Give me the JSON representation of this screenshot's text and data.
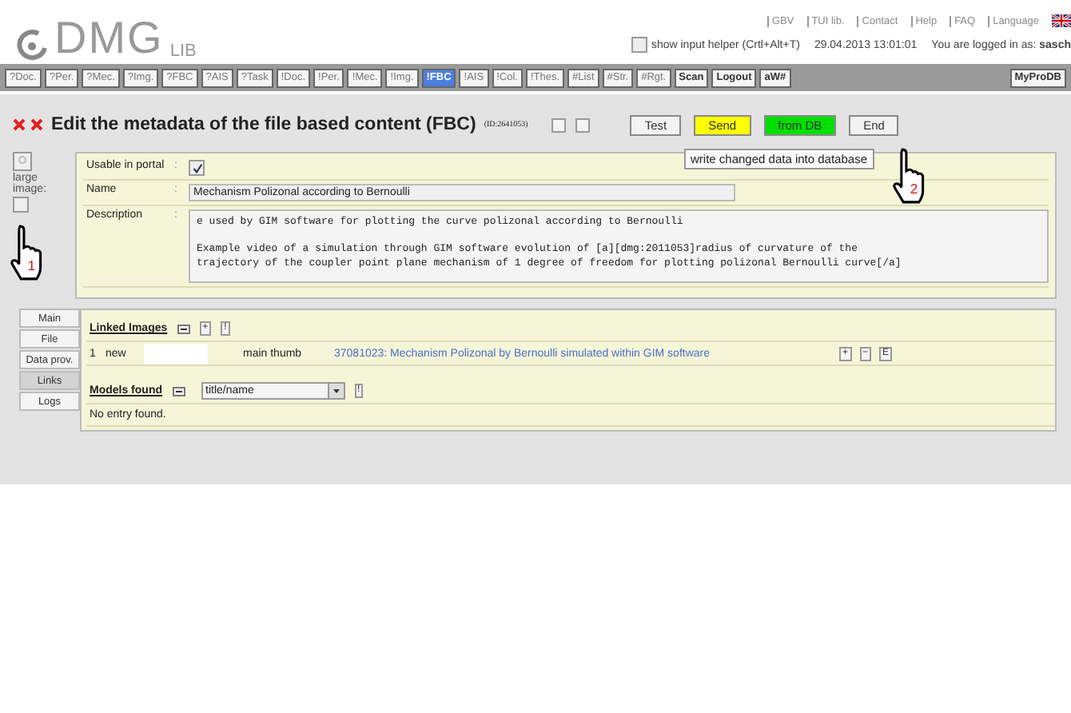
{
  "logo": {
    "main": "DMG",
    "sub": "LIB"
  },
  "top_links": [
    "GBV",
    "TUI lib.",
    "Contact",
    "Help",
    "FAQ",
    "Language"
  ],
  "helper": {
    "label": "show input helper (Crtl+Alt+T)",
    "checked": false
  },
  "datetime": "29.04.2013 13:01:01",
  "login": {
    "label": "You are logged in as:",
    "user": "sasch"
  },
  "toolbar": [
    {
      "label": "?Doc.",
      "kind": "tool",
      "selected": false
    },
    {
      "label": "?Per.",
      "kind": "tool",
      "selected": false
    },
    {
      "label": "?Mec.",
      "kind": "tool",
      "selected": false
    },
    {
      "label": "?Img.",
      "kind": "tool",
      "selected": false
    },
    {
      "label": "?FBC",
      "kind": "tool",
      "selected": false
    },
    {
      "label": "?AIS",
      "kind": "tool",
      "selected": false
    },
    {
      "label": "?Task",
      "kind": "tool",
      "selected": false
    },
    {
      "label": "!Doc.",
      "kind": "tool",
      "selected": false
    },
    {
      "label": "!Per.",
      "kind": "tool",
      "selected": false
    },
    {
      "label": "!Mec.",
      "kind": "tool",
      "selected": false
    },
    {
      "label": "!Img.",
      "kind": "tool",
      "selected": false
    },
    {
      "label": "!FBC",
      "kind": "tool",
      "selected": true
    },
    {
      "label": "!AIS",
      "kind": "tool",
      "selected": false
    },
    {
      "label": "!Col.",
      "kind": "tool",
      "selected": false
    },
    {
      "label": "!Thes.",
      "kind": "tool",
      "selected": false
    },
    {
      "label": "#List",
      "kind": "tool",
      "selected": false
    },
    {
      "label": "#Str.",
      "kind": "tool",
      "selected": false
    },
    {
      "label": "#Rgt.",
      "kind": "tool",
      "selected": false
    },
    {
      "label": "Scan",
      "kind": "action",
      "selected": false
    },
    {
      "label": "Logout",
      "kind": "action",
      "selected": false
    },
    {
      "label": "aW#",
      "kind": "action",
      "selected": false
    }
  ],
  "toolbar_right": "MyProDB",
  "title": "Edit the metadata of the file based content (FBC)",
  "title_id": "(ID:2641053)",
  "buttons": [
    {
      "label": "Test",
      "kind": "plain"
    },
    {
      "label": "Send",
      "kind": "send"
    },
    {
      "label": "from DB",
      "kind": "load"
    },
    {
      "label": "End",
      "kind": "plain"
    }
  ],
  "tooltip": "write changed data into database",
  "large_image": {
    "label": "large image:",
    "checked": false
  },
  "fields": [
    {
      "label": "Usable in portal",
      "kind": "checkbox",
      "checked": true
    },
    {
      "label": "Name",
      "kind": "text",
      "value": "Mechanism Polizonal according to Bernoulli"
    },
    {
      "label": "Description",
      "kind": "textarea",
      "paragraphs": [
        [
          "e used by GIM software for plotting the curve polizonal according to Bernoulli"
        ],
        [
          "Example video of a simulation through GIM software evolution of [a][dmg:2011053]radius of curvature of the",
          "trajectory of the coupler point plane mechanism of 1 degree of freedom for plotting polizonal Bernoulli curve[/a]"
        ]
      ]
    }
  ],
  "field_separator": ":",
  "tabs": [
    {
      "label": "Main",
      "selected": false
    },
    {
      "label": "File",
      "selected": false
    },
    {
      "label": "Data prov.",
      "selected": false
    },
    {
      "label": "Links",
      "selected": true
    },
    {
      "label": "Logs",
      "selected": false
    }
  ],
  "linked_images": {
    "title": "Linked Images",
    "header_buttons": [
      "+",
      "!"
    ],
    "rows": [
      {
        "index": "1",
        "status": "new",
        "role": "main thumb",
        "link": "37081023: Mechanism Polizonal by Bernoulli simulated within GIM software",
        "buttons": [
          "+",
          "−",
          "E"
        ]
      }
    ]
  },
  "models_found": {
    "title": "Models found",
    "select": "title/name",
    "button": "!",
    "empty": "No entry found."
  },
  "cursors": [
    {
      "number": "1"
    },
    {
      "number": "2"
    }
  ]
}
